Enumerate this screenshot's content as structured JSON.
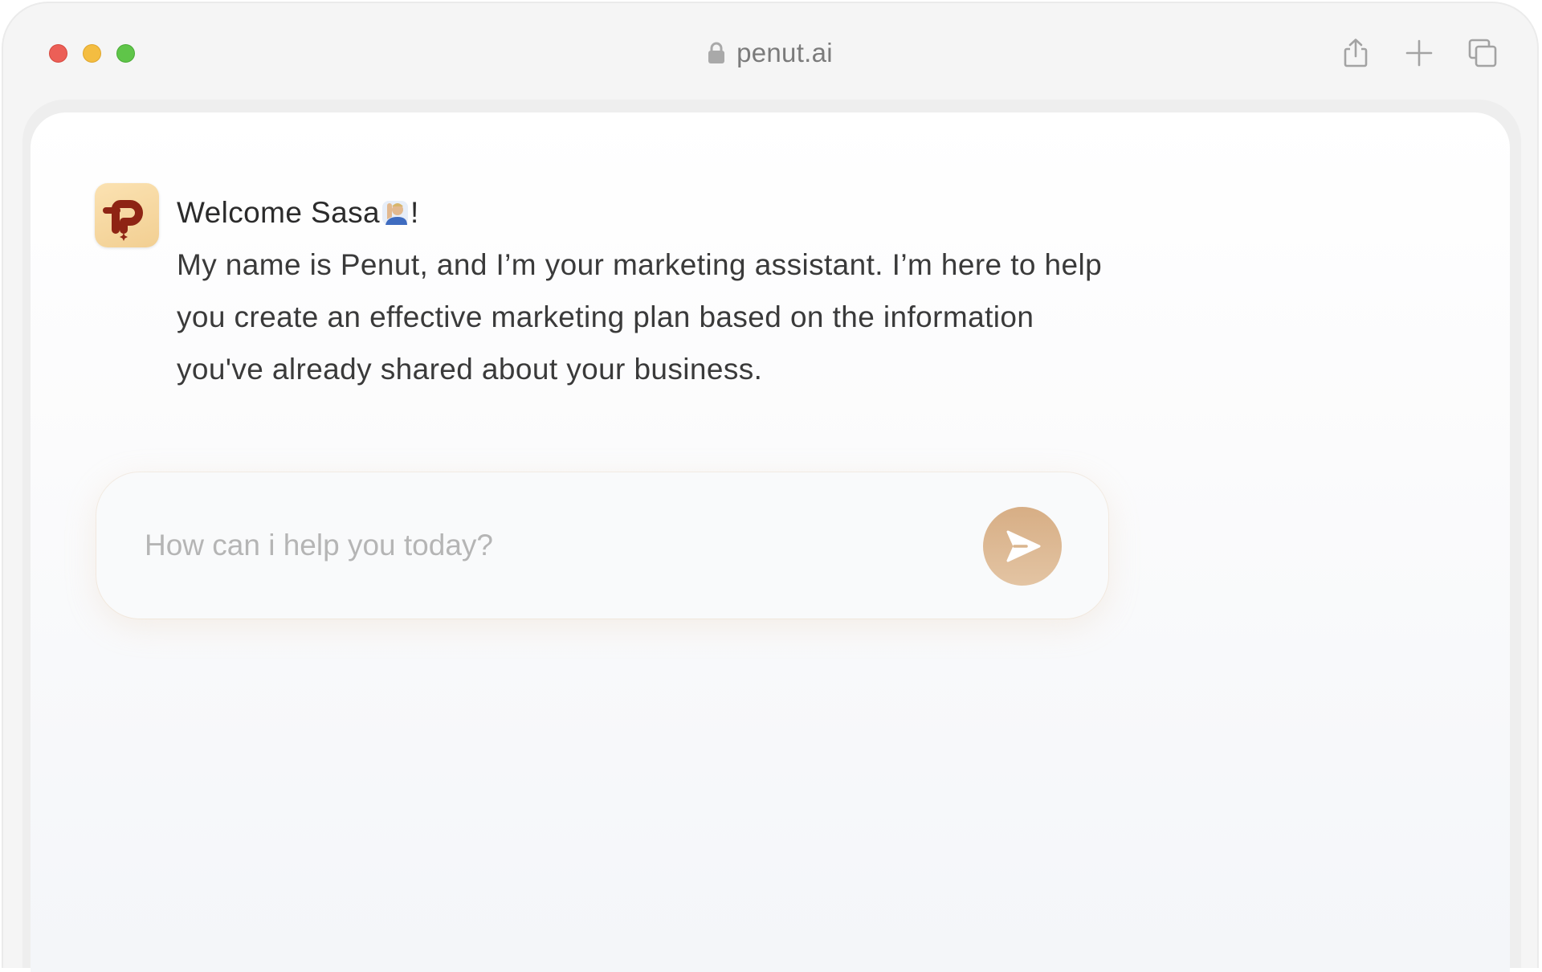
{
  "browser": {
    "url": "penut.ai",
    "icons": [
      "share-icon",
      "plus-icon",
      "tabs-icon",
      "lock-icon"
    ]
  },
  "chat": {
    "greeting_prefix": "Welcome Sasa",
    "greeting_emoji": "raising-hand-emoji",
    "greeting_suffix": "!",
    "message_lines": [
      "My name is Penut, and I’m your marketing assistant. I’m here to help",
      "you create an effective marketing plan based on the information",
      "you've already shared about your business."
    ],
    "avatar_icon": "penut-logo-icon"
  },
  "composer": {
    "placeholder": "How can i help you today?",
    "send_icon": "send-icon"
  },
  "colors": {
    "accent": "#d9b48c",
    "avatar_bg": "#f6d9a4",
    "logo": "#8e2414",
    "traffic_red": "#ec5f57",
    "traffic_yellow": "#f4bd41",
    "traffic_green": "#5fc549"
  }
}
